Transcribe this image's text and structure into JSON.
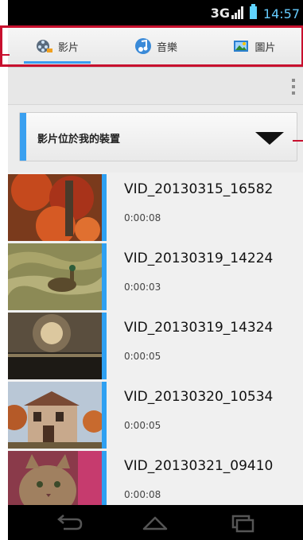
{
  "status_bar": {
    "network": "3G",
    "time": "14:57"
  },
  "tabs": [
    {
      "label": "影片",
      "icon": "film-reel-icon",
      "active": true
    },
    {
      "label": "音樂",
      "icon": "music-note-icon",
      "active": false
    },
    {
      "label": "圖片",
      "icon": "picture-icon",
      "active": false
    }
  ],
  "location": {
    "label": "影片位於我的裝置"
  },
  "videos": [
    {
      "title": "VID_20130315_16582",
      "duration": "0:00:08"
    },
    {
      "title": "VID_20130319_14224",
      "duration": "0:00:03"
    },
    {
      "title": "VID_20130319_14324",
      "duration": "0:00:05"
    },
    {
      "title": "VID_20130320_10534",
      "duration": "0:00:05"
    },
    {
      "title": "VID_20130321_09410",
      "duration": "0:00:08"
    }
  ],
  "colors": {
    "accent": "#2ea0f2",
    "annotation": "#c8102e"
  }
}
